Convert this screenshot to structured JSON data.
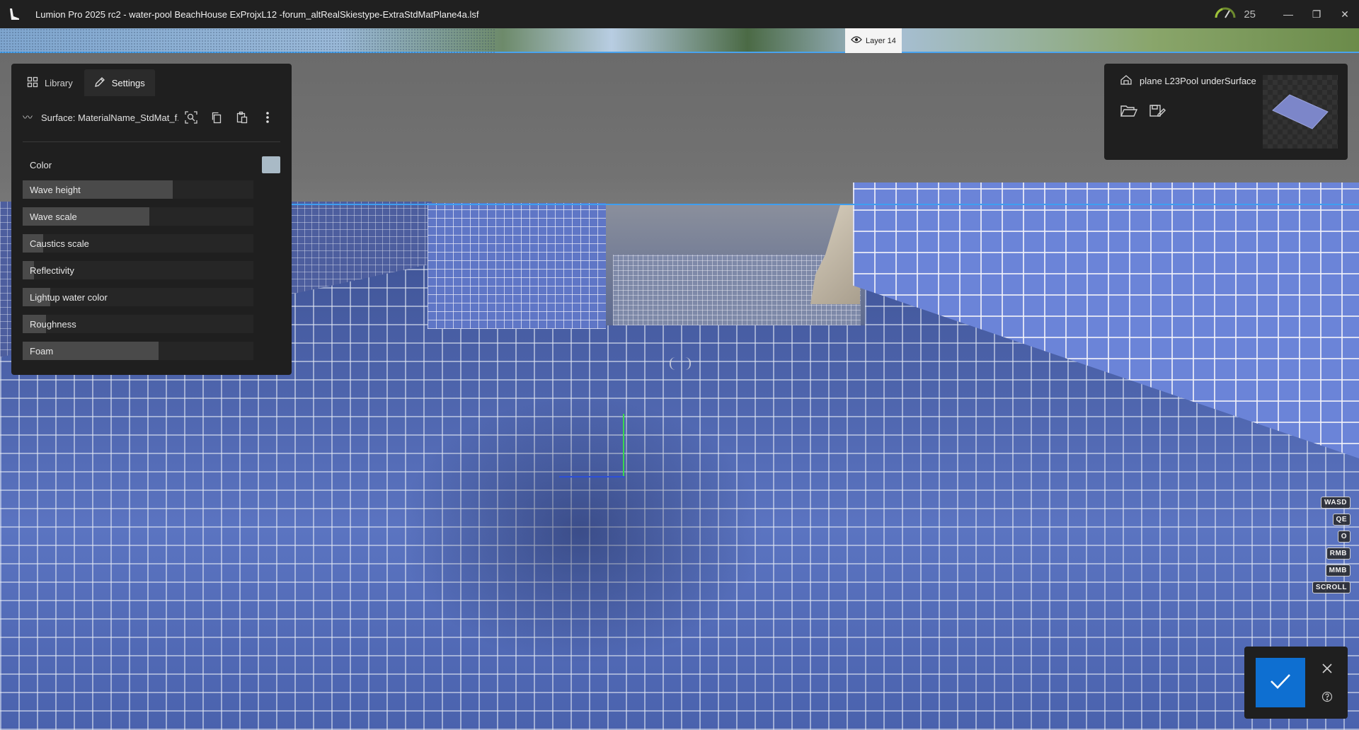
{
  "window": {
    "title": "Lumion Pro 2025 rc2 - water-pool BeachHouse ExProjxL12 -forum_altRealSkiestype-ExtraStdMatPlane4a.lsf",
    "perf_value": "25",
    "minimize_glyph": "—",
    "restore_glyph": "❐",
    "close_glyph": "✕"
  },
  "viewport": {
    "layer_label": "Layer 14"
  },
  "left_panel": {
    "tabs": [
      {
        "label": "Library",
        "icon": "grid-icon",
        "active": false
      },
      {
        "label": "Settings",
        "icon": "pencil-icon",
        "active": true
      }
    ],
    "surface_label": "Surface: MaterialName_StdMat_f...",
    "color": {
      "label": "Color",
      "value": "#a9bac6"
    },
    "sliders": [
      {
        "label": "Wave height",
        "value": 0.65
      },
      {
        "label": "Wave scale",
        "value": 0.55
      },
      {
        "label": "Caustics scale",
        "value": 0.09
      },
      {
        "label": "Reflectivity",
        "value": 0.05
      },
      {
        "label": "Lightup water color",
        "value": 0.12
      },
      {
        "label": "Roughness",
        "value": 0.1
      },
      {
        "label": "Foam",
        "value": 0.59
      }
    ]
  },
  "object_panel": {
    "name": "plane L23Pool underSurface"
  },
  "hints": [
    "WASD",
    "QE",
    "O",
    "RMB",
    "MMB",
    "SCROLL"
  ],
  "colors": {
    "accent": "#0e6fd1",
    "horizon": "#3e9ef0",
    "tile_blue": "#4c63ad"
  }
}
